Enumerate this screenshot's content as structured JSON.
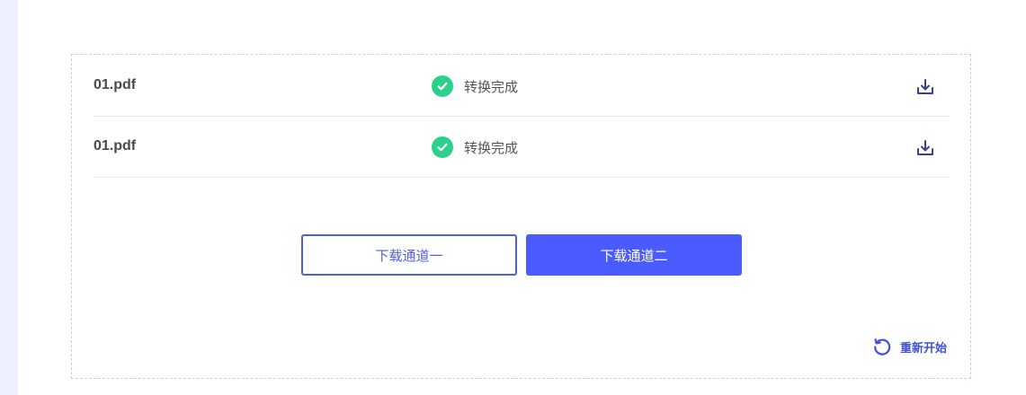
{
  "files": [
    {
      "name": "01.pdf",
      "status": "转换完成"
    },
    {
      "name": "01.pdf",
      "status": "转换完成"
    }
  ],
  "buttons": {
    "channel_one": "下载通道一",
    "channel_two": "下载通道二"
  },
  "restart_label": "重新开始",
  "colors": {
    "accent": "#4a5cff",
    "success": "#2bd18a",
    "border": "#c9cdf2"
  },
  "icons": {
    "status": "check-circle-icon",
    "download": "download-icon",
    "restart": "refresh-icon"
  }
}
